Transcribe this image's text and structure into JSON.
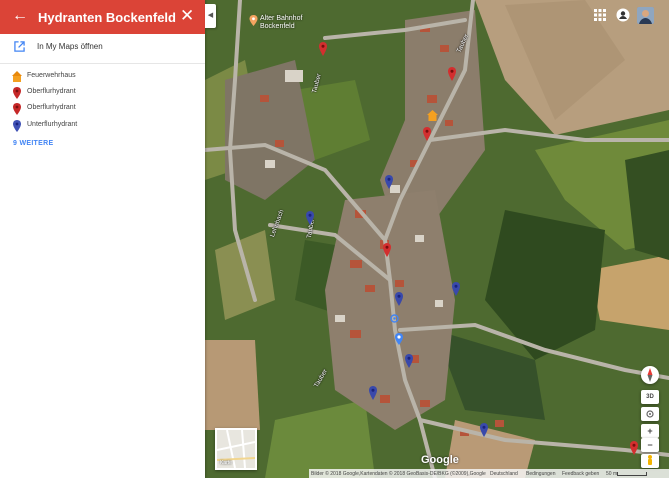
{
  "sidebar": {
    "title": "Hydranten Bockenfeld",
    "header_color": "#db4437",
    "open_in_my_maps": "In My Maps öffnen",
    "legend": [
      {
        "label": "Feuerwehrhaus",
        "icon": "house-marker-icon",
        "color": "#f4a020"
      },
      {
        "label": "Oberflurhydrant",
        "icon": "red-pin-icon",
        "color": "#c62828"
      },
      {
        "label": "Oberflurhydrant",
        "icon": "red-pin-icon",
        "color": "#c62828"
      },
      {
        "label": "Unterflurhydrant",
        "icon": "blue-pin-icon",
        "color": "#3f51b5"
      }
    ],
    "more_link": "9 WEITERE"
  },
  "map": {
    "poi_name": "Alter Bahnhof Bockenfeld",
    "street_labels": [
      "Tauber",
      "Tauber",
      "Lehnbach",
      "Tauber",
      "Tauber"
    ],
    "logo": "Google",
    "minimap_label": "Karte",
    "controls": {
      "three_d": "3D",
      "zoom_in": "+",
      "zoom_out": "−"
    },
    "attribution": {
      "imagery": "Bilder © 2018 Google,Kartendaten © 2018 GeoBasis-DE/BKG (©2009),Google",
      "country": "Deutschland",
      "terms": "Bedingungen",
      "feedback": "Feedback geben",
      "scale": "50 m"
    },
    "pin_colors": {
      "red": "#d32f2f",
      "blue": "#3949ab",
      "house": "#f4a020"
    }
  }
}
